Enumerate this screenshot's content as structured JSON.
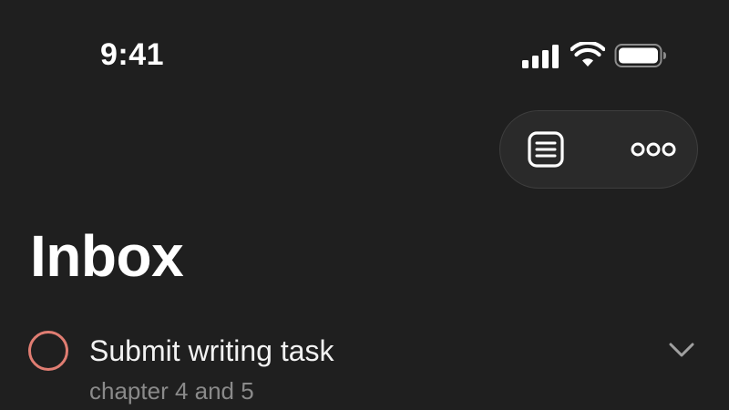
{
  "status_bar": {
    "time": "9:41",
    "signal_icon": "cellular-signal-icon",
    "wifi_icon": "wifi-icon",
    "battery_icon": "battery-icon"
  },
  "toolbar": {
    "list_icon": "list-icon",
    "more_icon": "more-icon"
  },
  "page": {
    "title": "Inbox"
  },
  "tasks": [
    {
      "title": "Submit writing task",
      "note": "chapter 4 and 5",
      "checkbox_color": "#e07d72",
      "completed": false,
      "expand_icon": "chevron-down-icon"
    }
  ],
  "colors": {
    "background": "#1f1f1f",
    "text_primary": "#ffffff",
    "text_secondary": "#8a8a8a",
    "priority": "#e07d72"
  }
}
